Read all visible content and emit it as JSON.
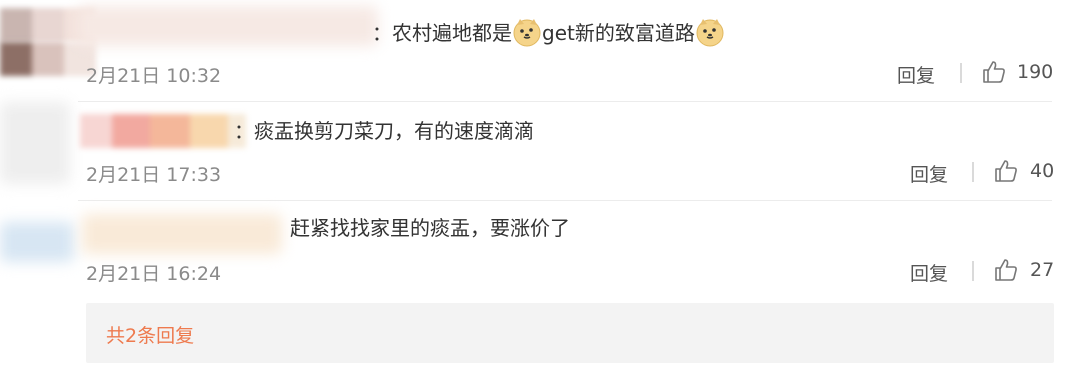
{
  "comments": [
    {
      "text": "：农村遍地都是",
      "text_after_emoji": "get新的致富道路",
      "emoji_icon": "doge-face-icon",
      "time": "2月21日 10:32",
      "reply_label": "回复",
      "likes": "190"
    },
    {
      "text": "：痰盂换剪刀菜刀，有的速度滴滴",
      "time": "2月21日 17:33",
      "reply_label": "回复",
      "likes": "40"
    },
    {
      "text": "赶紧找找家里的痰盂，要涨价了",
      "time": "2月21日 16:24",
      "reply_label": "回复",
      "likes": "27"
    }
  ],
  "reply_summary": "共2条回复",
  "colors": {
    "accent_link": "#ee7a4e",
    "text": "#333333",
    "muted": "#8a8a8a",
    "reply_box_bg": "#f3f3f3"
  }
}
